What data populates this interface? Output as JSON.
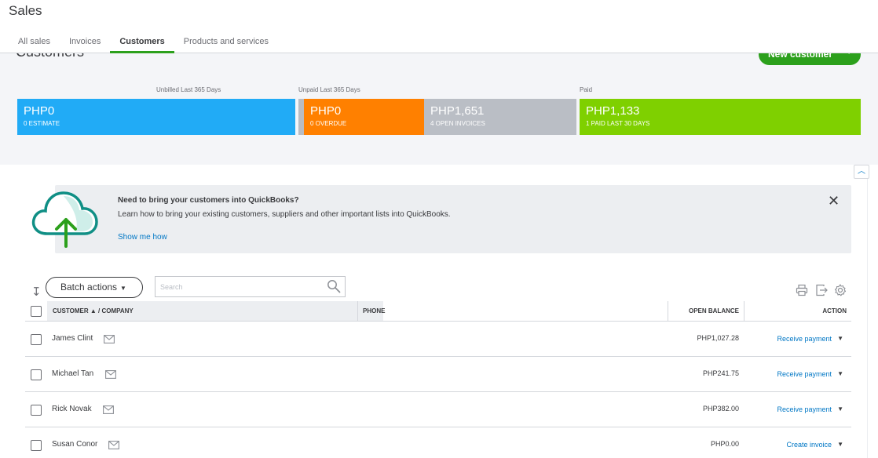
{
  "header": {
    "title": "Sales",
    "tabs": [
      {
        "label": "All sales"
      },
      {
        "label": "Invoices"
      },
      {
        "label": "Customers"
      },
      {
        "label": "Products and services"
      }
    ]
  },
  "summary": {
    "heading": "Customers",
    "new_customer_label": "New customer",
    "labels": {
      "unbilled": "Unbilled Last 365 Days",
      "unpaid": "Unpaid Last 365 Days",
      "paid": "Paid"
    },
    "bands": [
      {
        "amount": "PHP0",
        "sub": "0 ESTIMATE",
        "color": "#21abf6"
      },
      {
        "amount": "PHP0",
        "sub": "0 OVERDUE",
        "color": "#ff8000"
      },
      {
        "amount": "PHP1,651",
        "sub": "4 OPEN INVOICES",
        "color": "#babec5"
      },
      {
        "amount": "PHP1,133",
        "sub": "1 PAID LAST 30 DAYS",
        "color": "#7fd000"
      }
    ]
  },
  "banner": {
    "title": "Need to bring your customers into QuickBooks?",
    "text": "Learn how to bring your existing customers, suppliers and other important lists into QuickBooks.",
    "link": "Show me how"
  },
  "toolbar": {
    "batch_label": "Batch actions",
    "search_placeholder": "Search"
  },
  "table": {
    "headers": {
      "customer": "CUSTOMER ▲ / COMPANY",
      "phone": "PHONE",
      "balance": "OPEN BALANCE",
      "action": "ACTION"
    },
    "rows": [
      {
        "name": "James Clint",
        "balance": "PHP1,027.28",
        "action": "Receive payment"
      },
      {
        "name": "Michael Tan",
        "balance": "PHP241.75",
        "action": "Receive payment"
      },
      {
        "name": "Rick Novak",
        "balance": "PHP382.00",
        "action": "Receive payment"
      },
      {
        "name": "Susan Conor",
        "balance": "PHP0.00",
        "action": "Create invoice"
      }
    ]
  },
  "colors": {
    "brand_green": "#2ca01c",
    "link_blue": "#0077c5"
  },
  "icons": {
    "cloud_upload": "cloud-upload-icon",
    "search": "search-icon",
    "print": "print-icon",
    "export": "export-icon",
    "settings": "gear-icon",
    "email": "mail-icon",
    "close": "close-icon"
  }
}
